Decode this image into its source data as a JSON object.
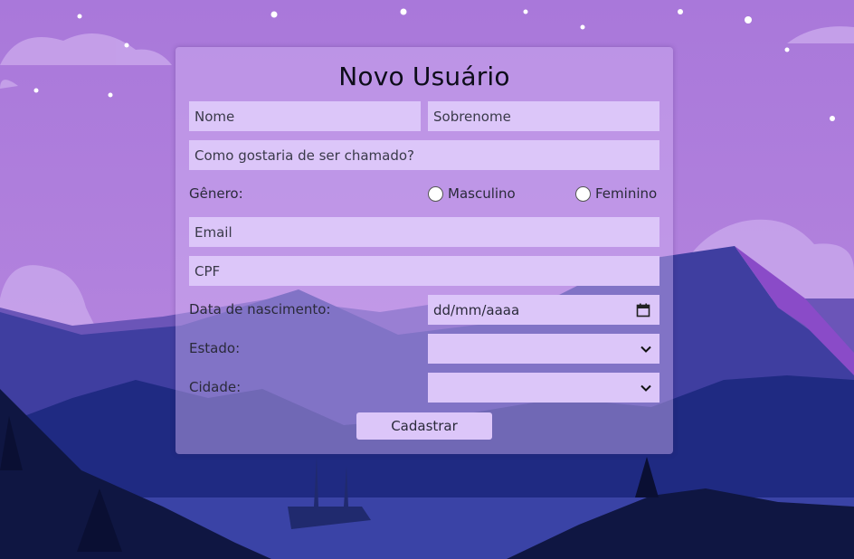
{
  "form": {
    "title": "Novo Usuário",
    "nome_placeholder": "Nome",
    "sobrenome_placeholder": "Sobrenome",
    "apelido_placeholder": "Como gostaria de ser chamado?",
    "genero_label": "Gênero:",
    "genero_options": [
      "Masculino",
      "Feminino"
    ],
    "email_placeholder": "Email",
    "cpf_placeholder": "CPF",
    "nascimento_label": "Data de nascimento:",
    "nascimento_placeholder": "dd/mm/aaaa",
    "estado_label": "Estado:",
    "estado_value": "",
    "cidade_label": "Cidade:",
    "cidade_value": "",
    "submit_label": "Cadastrar"
  },
  "icons": {
    "calendar": "calendar-icon",
    "chevron": "chevron-down-icon"
  },
  "colors": {
    "sky": "#b07fdc",
    "field_bg": "#dcc6f9",
    "mountain_dark": "#0d1950"
  }
}
